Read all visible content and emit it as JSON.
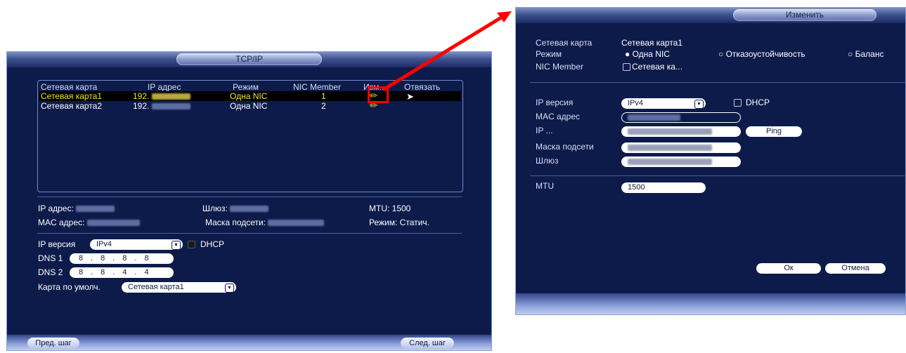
{
  "left": {
    "title": "TCP/IP",
    "table": {
      "headers": [
        "Сетевая карта",
        "IP адрес",
        "Режим",
        "NIC Member",
        "Изм...",
        "Отвязать"
      ],
      "rows": [
        {
          "card": "Сетевая карта1",
          "ip": "192.",
          "mode": "Одна NIC",
          "member": "1"
        },
        {
          "card": "Сетевая карта2",
          "ip": "192.",
          "mode": "Одна NIC",
          "member": "2"
        }
      ]
    },
    "info": {
      "ip_label": "IP адрес:",
      "gateway_label": "Шлюз:",
      "mtu": "MTU: 1500",
      "mac_label": "MAC адрес:",
      "mask_label": "Маска подсети:",
      "mode": "Режим: Статич."
    },
    "ip_version_label": "IP версия",
    "ip_version_value": "IPv4",
    "dhcp_label": "DHCP",
    "dns1_label": "DNS 1",
    "dns1": [
      "8",
      "8",
      "8",
      "8"
    ],
    "dns2_label": "DNS 2",
    "dns2": [
      "8",
      "8",
      "4",
      "4"
    ],
    "default_card_label": "Карта по умолч.",
    "default_card_value": "Сетевая карта1",
    "prev_button": "Пред. шаг",
    "next_button": "След. шаг"
  },
  "right": {
    "title": "Изменить",
    "card_label": "Сетевая карта",
    "card_value": "Сетевая карта1",
    "mode_label": "Режим",
    "mode_options": [
      "Одна NIC",
      "Отказоустойчивость",
      "Баланс"
    ],
    "member_label": "NIC Member",
    "member_value": "Сетевая ка...",
    "ip_version_label": "IP версия",
    "ip_version_value": "IPv4",
    "dhcp_label": "DHCP",
    "mac_label": "MAC адрес",
    "ip_label": "IP ...",
    "ping_button": "Ping",
    "mask_label": "Маска подсети",
    "gateway_label": "Шлюз",
    "mtu_label": "MTU",
    "mtu_value": "1500",
    "ok_button": "Ок",
    "cancel_button": "Отмена"
  },
  "colors": {
    "panel_bg": "#0d1b4a",
    "highlight_row": "#000000",
    "highlight_text": "#f0e020",
    "annotation_red": "#ff0000"
  }
}
